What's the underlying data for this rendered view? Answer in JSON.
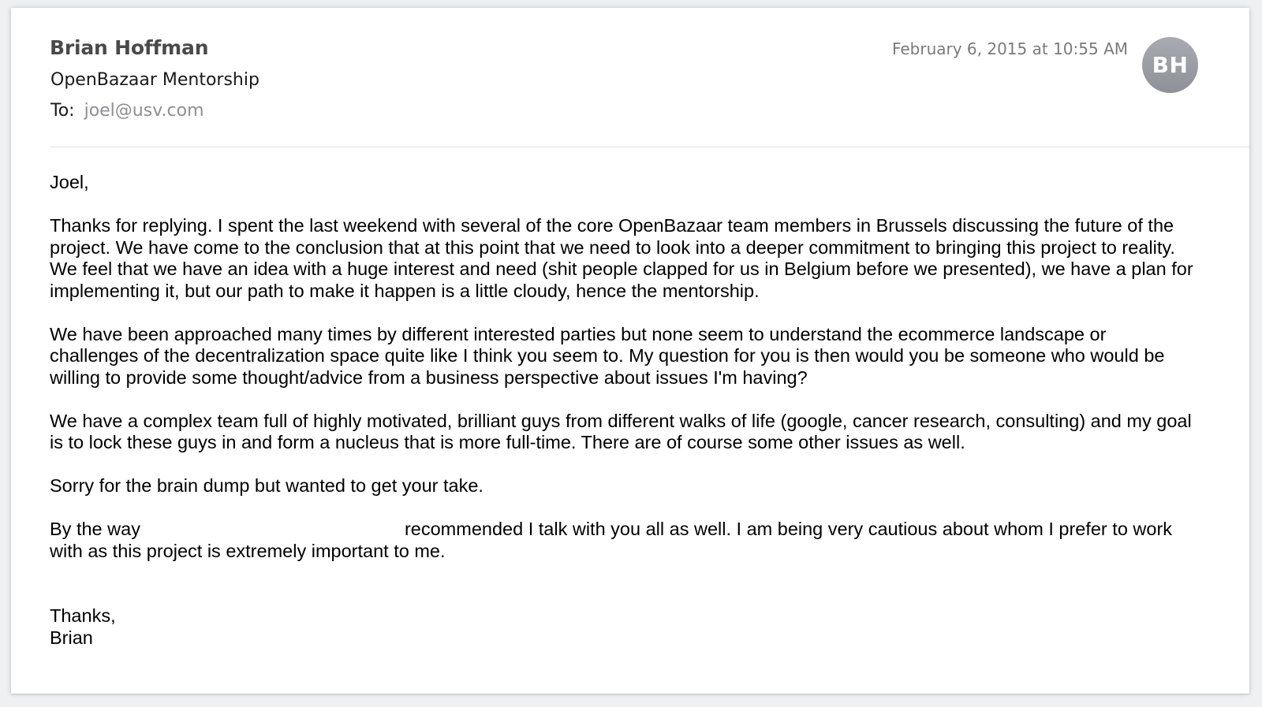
{
  "email": {
    "sender_name": "Brian Hoffman",
    "subject": "OpenBazaar Mentorship",
    "to_label": "To:",
    "to_address": "joel@usv.com",
    "timestamp": "February 6, 2015 at 10:55 AM",
    "avatar_initials": "BH"
  },
  "body": {
    "greeting": "Joel,",
    "paragraph_1": "Thanks for replying. I spent the last weekend with several of the core OpenBazaar team members in Brussels discussing the future of the project. We have come to the conclusion that at this point that we need to look into a deeper commitment to bringing this project to reality. We feel that we have an idea with a huge interest and need (shit people clapped for us in Belgium before we presented), we have a plan for implementing it, but our path to make it happen is a little cloudy, hence the mentorship.",
    "paragraph_2": "We have been approached many times by different interested parties but none seem to understand the ecommerce landscape or challenges of the decentralization space quite like I think you seem to. My question for you is then would you be someone who would be willing to provide some thought/advice from a business perspective about issues I'm having?",
    "paragraph_3": "We have a complex team full of highly motivated, brilliant guys from different walks of life (google, cancer research, consulting) and my goal is to lock these guys in and form a nucleus that is more full-time. There are of course some other issues as well.",
    "paragraph_4": "Sorry for the brain dump but wanted to get your take.",
    "paragraph_5_start": "By the way",
    "paragraph_5_end": "recommended I talk with you all as well. I am being very cautious about whom I prefer to work with as this project is extremely important to me.",
    "signoff": "Thanks,",
    "signature": "Brian"
  },
  "colors": {
    "background": "#eef0f2",
    "card": "#ffffff",
    "sender": "#4a4a4a",
    "muted": "#8e8e93",
    "avatar": "#9a9da3"
  }
}
